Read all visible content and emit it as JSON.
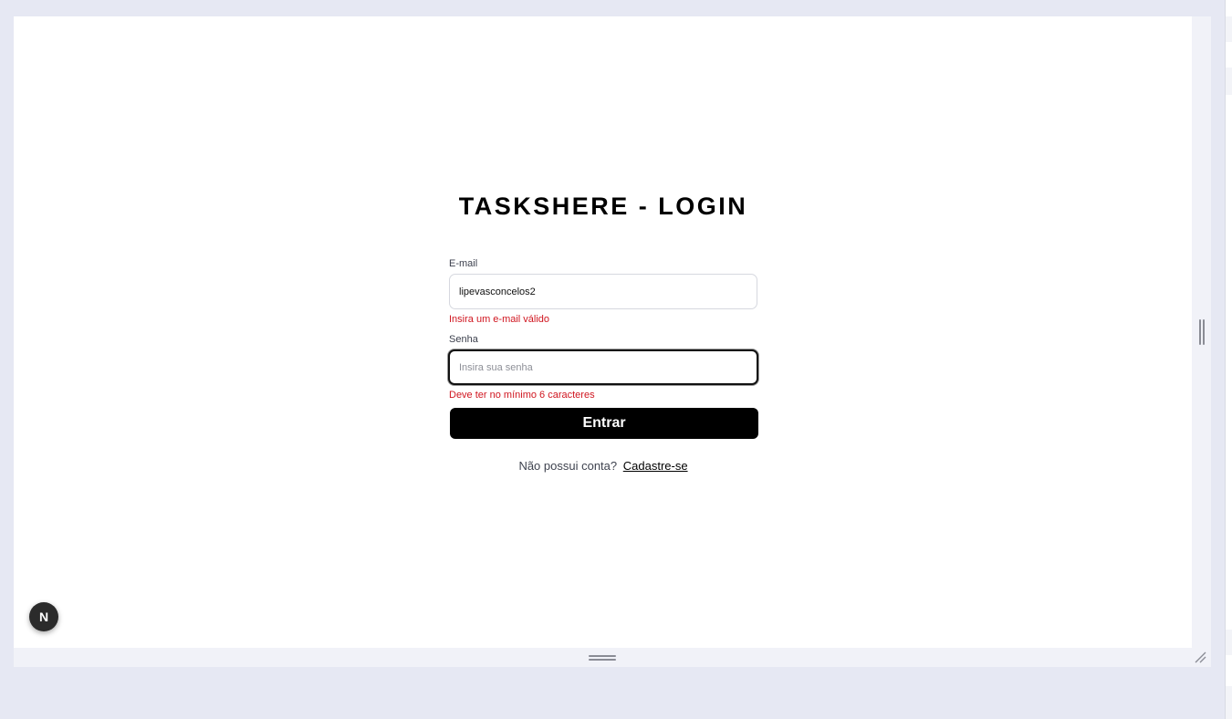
{
  "login": {
    "title": "TASKSHERE - LOGIN",
    "email": {
      "label": "E-mail",
      "value": "lipevasconcelos2",
      "error": "Insira um e-mail válido"
    },
    "password": {
      "label": "Senha",
      "placeholder": "Insira sua senha",
      "value": "",
      "error": "Deve ter no mínimo 6 caracteres"
    },
    "submit_label": "Entrar",
    "signup_prompt": "Não possui conta?",
    "signup_link": "Cadastre-se"
  },
  "dev_badge": {
    "letter": "N",
    "icon": "nextjs-icon"
  },
  "colors": {
    "error": "#d0151f",
    "button_bg": "#000000",
    "frame_bg": "#e6e8f3"
  }
}
